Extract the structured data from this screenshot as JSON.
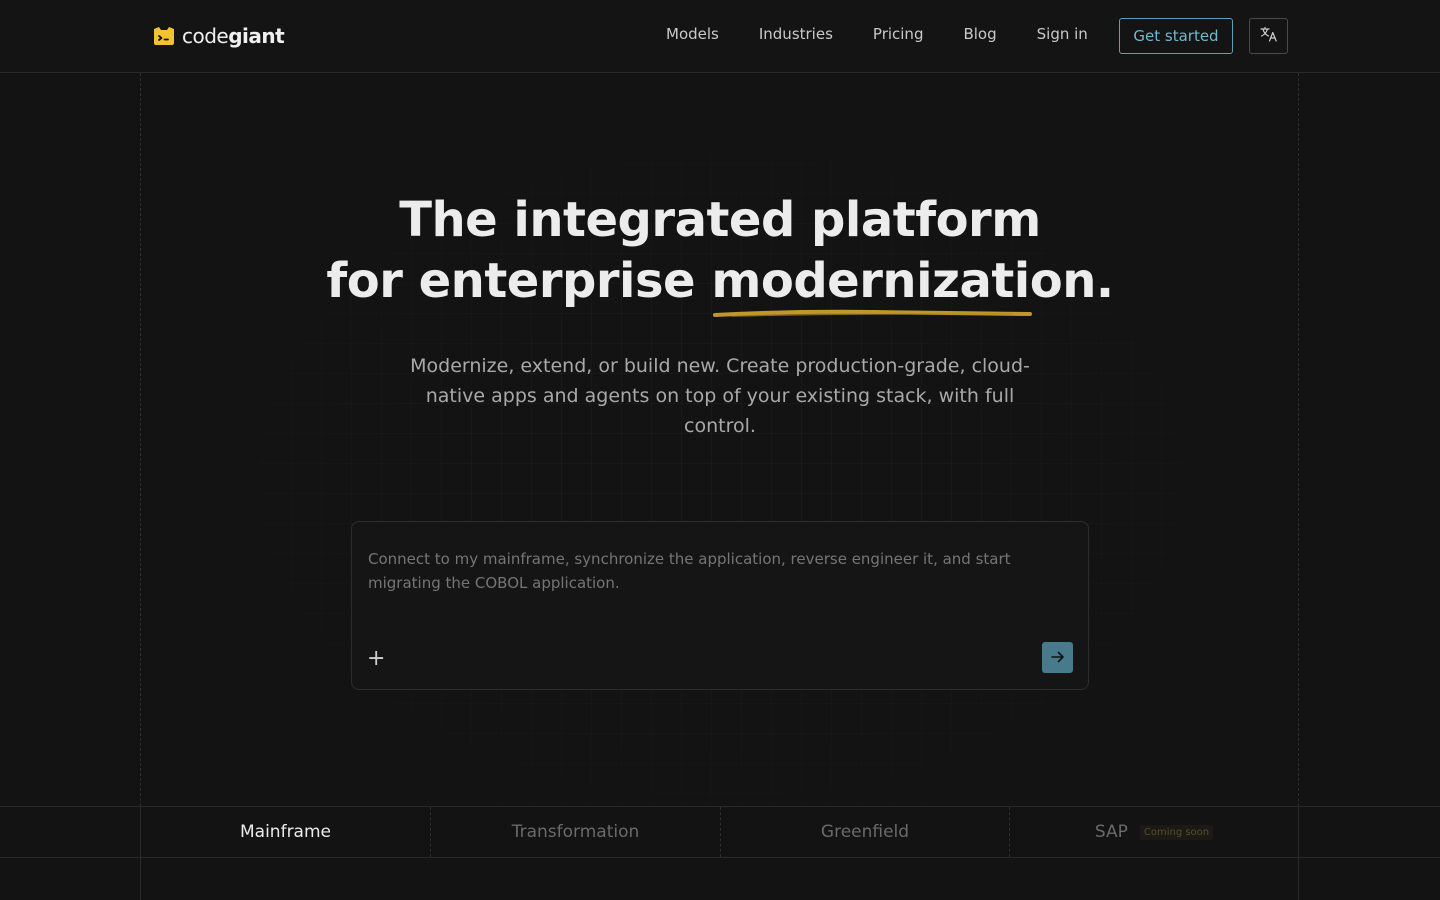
{
  "header": {
    "logo": {
      "text_light": "code",
      "text_bold": "giant"
    },
    "nav": [
      {
        "label": "Models"
      },
      {
        "label": "Industries"
      },
      {
        "label": "Pricing"
      },
      {
        "label": "Blog"
      },
      {
        "label": "Sign in"
      }
    ],
    "get_started_label": "Get started",
    "language_icon": "translate-icon"
  },
  "hero": {
    "headline_line1": "The integrated platform",
    "headline_line2_prefix": "for enterprise ",
    "headline_line2_highlight": "modernization",
    "headline_line2_suffix": ".",
    "subtitle": "Modernize, extend, or build new. Create production-grade, cloud-native apps and agents on top of your existing stack, with full control.",
    "underline_color": "#d4a72c"
  },
  "prompt": {
    "placeholder": "Connect to my mainframe, synchronize the application, reverse engineer it, and start migrating the COBOL application.",
    "add_icon": "plus-icon",
    "send_icon": "arrow-right-icon",
    "send_color": "#467a8c"
  },
  "tabs": [
    {
      "label": "Mainframe",
      "active": true
    },
    {
      "label": "Transformation",
      "active": false
    },
    {
      "label": "Greenfield",
      "active": false
    },
    {
      "label": "SAP",
      "active": false,
      "badge": "Coming soon"
    }
  ],
  "colors": {
    "accent": "#6fb8d0",
    "logo": "#f2c230",
    "background": "#131313"
  }
}
